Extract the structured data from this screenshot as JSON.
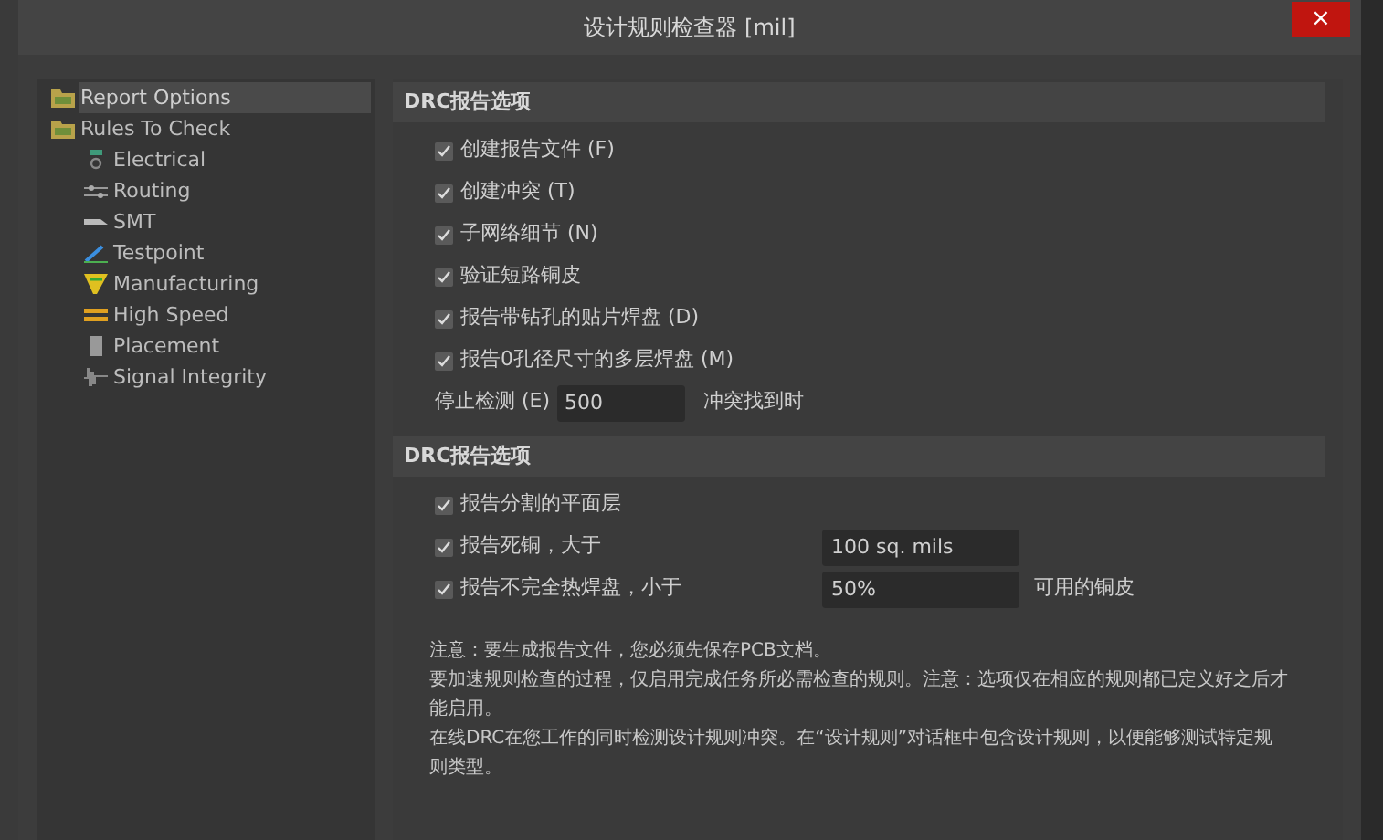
{
  "window": {
    "title": "设计规则检查器 [mil]",
    "close": "×"
  },
  "tree": [
    {
      "label": "Report Options",
      "kind": "folder",
      "selected": true
    },
    {
      "label": "Rules To Check",
      "kind": "folder",
      "selected": false,
      "children": [
        {
          "label": "Electrical",
          "kind": "electrical",
          "selected": false
        },
        {
          "label": "Routing",
          "kind": "routing",
          "selected": false
        },
        {
          "label": "SMT",
          "kind": "smt",
          "selected": false
        },
        {
          "label": "Testpoint",
          "kind": "testpoint",
          "selected": false
        },
        {
          "label": "Manufacturing",
          "kind": "manufacturing",
          "selected": false
        },
        {
          "label": "High Speed",
          "kind": "highspeed",
          "selected": false
        },
        {
          "label": "Placement",
          "kind": "placement",
          "selected": false
        },
        {
          "label": "Signal Integrity",
          "kind": "signal",
          "selected": false
        }
      ]
    }
  ],
  "sections": [
    {
      "title": "DRC报告选项",
      "rows": [
        {
          "kind": "checkbox",
          "label": "创建报告文件",
          "shortcut": "(F)",
          "checked": true
        },
        {
          "kind": "checkbox",
          "label": "创建冲突",
          "shortcut": "(T)",
          "checked": true
        },
        {
          "kind": "checkbox",
          "label": "子网络细节",
          "shortcut": "(N)",
          "checked": true
        },
        {
          "kind": "checkbox",
          "label": "验证短路铜皮",
          "checked": true
        },
        {
          "kind": "checkbox",
          "label": "报告带钻孔的贴片焊盘",
          "shortcut": "(D)",
          "checked": true
        },
        {
          "kind": "checkbox",
          "label": "报告0孔径尺寸的多层焊盘",
          "shortcut": "(M)",
          "checked": true
        },
        {
          "kind": "number",
          "label": "停止检测",
          "shortcut": "(E)",
          "value": "500",
          "suffix": "冲突找到时"
        }
      ]
    },
    {
      "title": "DRC报告选项",
      "rows": [
        {
          "kind": "checkbox",
          "label": "报告分割的平面层",
          "checked": true
        },
        {
          "kind": "checkbox",
          "label": "报告死铜，大于",
          "checked": true,
          "value": "100 sq. mils"
        },
        {
          "kind": "checkbox",
          "label": "报告不完全热焊盘，小于",
          "checked": true,
          "value": "50%",
          "suffix": "可用的铜皮"
        }
      ]
    }
  ],
  "notes": [
    "注意：要生成报告文件，您必须先保存PCB文档。",
    "要加速规则检查的过程，仅启用完成任务所必需检查的规则。注意：选项仅在相应的规则都已定义好之后才能启用。",
    "在线DRC在您工作的同时检测设计规则冲突。在“设计规则”对话框中包含设计规则，以便能够测试特定规则类型。"
  ]
}
